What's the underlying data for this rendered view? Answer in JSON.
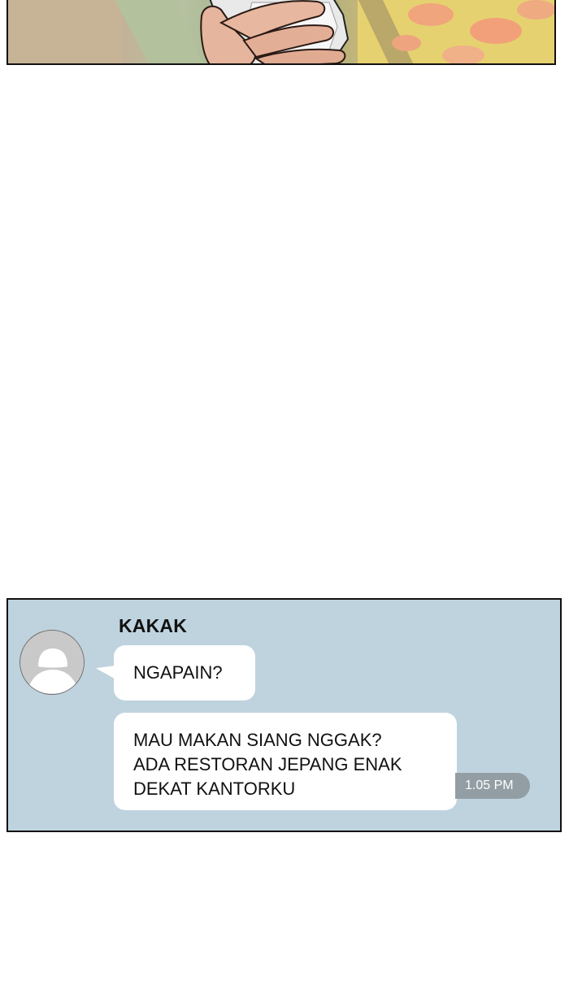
{
  "chat": {
    "sender_name": "KAKAK",
    "messages": [
      {
        "lines": [
          "NGAPAIN?"
        ]
      },
      {
        "lines": [
          "MAU MAKAN SIANG NGGAK?",
          "ADA RESTORAN JEPANG ENAK",
          "DEKAT KANTORKU"
        ]
      }
    ],
    "timestamp": "1.05 PM"
  },
  "colors": {
    "chat_background": "#bfd3df",
    "bubble": "#ffffff",
    "timestamp_background": "#939ea4"
  },
  "icons": {
    "avatar": "default-person-avatar-icon"
  }
}
